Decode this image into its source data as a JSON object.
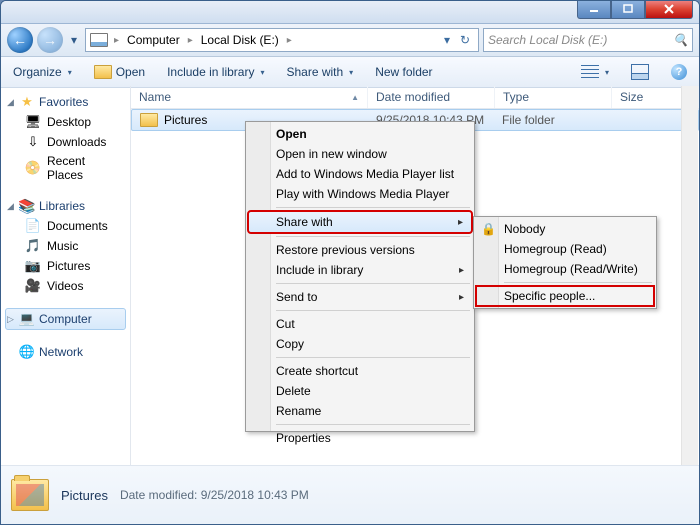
{
  "titlebar": {},
  "nav": {
    "breadcrumbs": [
      "Computer",
      "Local Disk (E:)"
    ],
    "search_placeholder": "Search Local Disk (E:)"
  },
  "toolbar": {
    "organize": "Organize",
    "open": "Open",
    "include": "Include in library",
    "share": "Share with",
    "newfolder": "New folder"
  },
  "sidebar": {
    "favorites": {
      "label": "Favorites",
      "items": [
        "Desktop",
        "Downloads",
        "Recent Places"
      ]
    },
    "libraries": {
      "label": "Libraries",
      "items": [
        "Documents",
        "Music",
        "Pictures",
        "Videos"
      ]
    },
    "computer": {
      "label": "Computer"
    },
    "network": {
      "label": "Network"
    }
  },
  "columns": {
    "name": "Name",
    "date": "Date modified",
    "type": "Type",
    "size": "Size"
  },
  "rows": [
    {
      "name": "Pictures",
      "date": "9/25/2018 10:43 PM",
      "type": "File folder",
      "size": ""
    }
  ],
  "context_main": [
    "Open",
    "Open in new window",
    "Add to Windows Media Player list",
    "Play with Windows Media Player",
    "---",
    "Share with",
    "---",
    "Restore previous versions",
    "Include in library",
    "---",
    "Send to",
    "---",
    "Cut",
    "Copy",
    "---",
    "Create shortcut",
    "Delete",
    "Rename",
    "---",
    "Properties"
  ],
  "context_sub": [
    "Nobody",
    "Homegroup (Read)",
    "Homegroup (Read/Write)",
    "---",
    "Specific people..."
  ],
  "details": {
    "name": "Pictures",
    "meta_label": "Date modified:",
    "meta_value": "9/25/2018 10:43 PM"
  }
}
